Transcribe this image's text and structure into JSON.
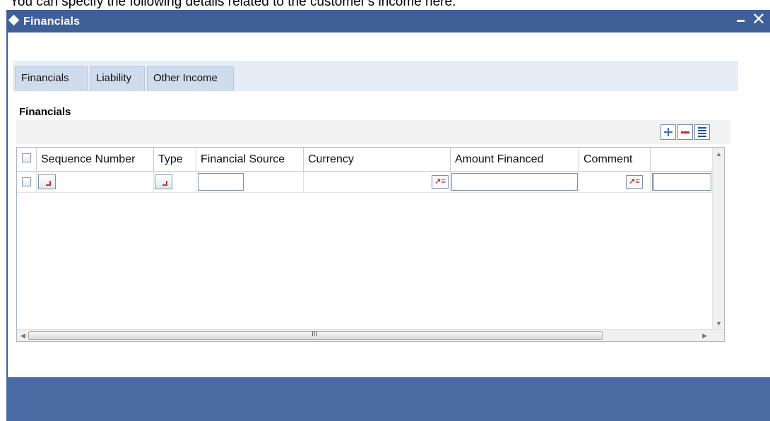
{
  "doc": {
    "intro_text": "You can specify the following details related to the customer's income here:"
  },
  "window": {
    "title": "Financials",
    "minimize_label": "–",
    "close_label": "✕"
  },
  "tabs": [
    {
      "label": "Financials",
      "active": true
    },
    {
      "label": "Liability",
      "active": false
    },
    {
      "label": "Other Income",
      "active": false
    }
  ],
  "section": {
    "title": "Financials",
    "toolbar": {
      "add": "plus-icon",
      "delete": "minus-icon",
      "view": "list-icon"
    }
  },
  "grid": {
    "columns": [
      "Sequence Number",
      "Type",
      "Financial Source",
      "Currency",
      "Amount Financed",
      "Comment"
    ],
    "rows": [
      {
        "sequence_number": "",
        "type": "",
        "financial_source": "",
        "currency": "",
        "amount_financed": "",
        "comment": ""
      }
    ],
    "scrollbar_grip": "III"
  },
  "colors": {
    "titlebar": "#3f5f98",
    "footer": "#4a6aa4",
    "tab_bg": "#cfdcee"
  }
}
